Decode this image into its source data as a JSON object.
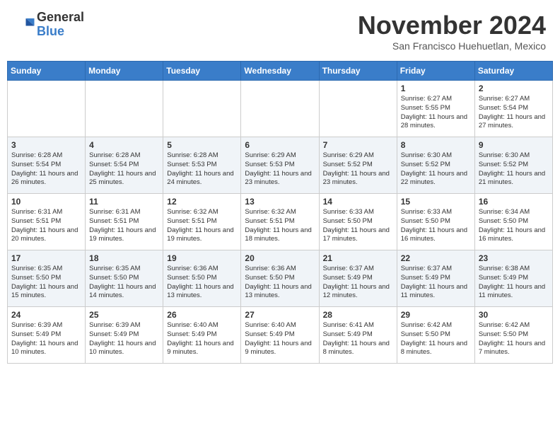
{
  "header": {
    "logo": {
      "general": "General",
      "blue": "Blue"
    },
    "title": "November 2024",
    "location": "San Francisco Huehuetlan, Mexico"
  },
  "weekdays": [
    "Sunday",
    "Monday",
    "Tuesday",
    "Wednesday",
    "Thursday",
    "Friday",
    "Saturday"
  ],
  "weeks": [
    [
      {
        "day": "",
        "info": ""
      },
      {
        "day": "",
        "info": ""
      },
      {
        "day": "",
        "info": ""
      },
      {
        "day": "",
        "info": ""
      },
      {
        "day": "",
        "info": ""
      },
      {
        "day": "1",
        "info": "Sunrise: 6:27 AM\nSunset: 5:55 PM\nDaylight: 11 hours and 28 minutes."
      },
      {
        "day": "2",
        "info": "Sunrise: 6:27 AM\nSunset: 5:54 PM\nDaylight: 11 hours and 27 minutes."
      }
    ],
    [
      {
        "day": "3",
        "info": "Sunrise: 6:28 AM\nSunset: 5:54 PM\nDaylight: 11 hours and 26 minutes."
      },
      {
        "day": "4",
        "info": "Sunrise: 6:28 AM\nSunset: 5:54 PM\nDaylight: 11 hours and 25 minutes."
      },
      {
        "day": "5",
        "info": "Sunrise: 6:28 AM\nSunset: 5:53 PM\nDaylight: 11 hours and 24 minutes."
      },
      {
        "day": "6",
        "info": "Sunrise: 6:29 AM\nSunset: 5:53 PM\nDaylight: 11 hours and 23 minutes."
      },
      {
        "day": "7",
        "info": "Sunrise: 6:29 AM\nSunset: 5:52 PM\nDaylight: 11 hours and 23 minutes."
      },
      {
        "day": "8",
        "info": "Sunrise: 6:30 AM\nSunset: 5:52 PM\nDaylight: 11 hours and 22 minutes."
      },
      {
        "day": "9",
        "info": "Sunrise: 6:30 AM\nSunset: 5:52 PM\nDaylight: 11 hours and 21 minutes."
      }
    ],
    [
      {
        "day": "10",
        "info": "Sunrise: 6:31 AM\nSunset: 5:51 PM\nDaylight: 11 hours and 20 minutes."
      },
      {
        "day": "11",
        "info": "Sunrise: 6:31 AM\nSunset: 5:51 PM\nDaylight: 11 hours and 19 minutes."
      },
      {
        "day": "12",
        "info": "Sunrise: 6:32 AM\nSunset: 5:51 PM\nDaylight: 11 hours and 19 minutes."
      },
      {
        "day": "13",
        "info": "Sunrise: 6:32 AM\nSunset: 5:51 PM\nDaylight: 11 hours and 18 minutes."
      },
      {
        "day": "14",
        "info": "Sunrise: 6:33 AM\nSunset: 5:50 PM\nDaylight: 11 hours and 17 minutes."
      },
      {
        "day": "15",
        "info": "Sunrise: 6:33 AM\nSunset: 5:50 PM\nDaylight: 11 hours and 16 minutes."
      },
      {
        "day": "16",
        "info": "Sunrise: 6:34 AM\nSunset: 5:50 PM\nDaylight: 11 hours and 16 minutes."
      }
    ],
    [
      {
        "day": "17",
        "info": "Sunrise: 6:35 AM\nSunset: 5:50 PM\nDaylight: 11 hours and 15 minutes."
      },
      {
        "day": "18",
        "info": "Sunrise: 6:35 AM\nSunset: 5:50 PM\nDaylight: 11 hours and 14 minutes."
      },
      {
        "day": "19",
        "info": "Sunrise: 6:36 AM\nSunset: 5:50 PM\nDaylight: 11 hours and 13 minutes."
      },
      {
        "day": "20",
        "info": "Sunrise: 6:36 AM\nSunset: 5:50 PM\nDaylight: 11 hours and 13 minutes."
      },
      {
        "day": "21",
        "info": "Sunrise: 6:37 AM\nSunset: 5:49 PM\nDaylight: 11 hours and 12 minutes."
      },
      {
        "day": "22",
        "info": "Sunrise: 6:37 AM\nSunset: 5:49 PM\nDaylight: 11 hours and 11 minutes."
      },
      {
        "day": "23",
        "info": "Sunrise: 6:38 AM\nSunset: 5:49 PM\nDaylight: 11 hours and 11 minutes."
      }
    ],
    [
      {
        "day": "24",
        "info": "Sunrise: 6:39 AM\nSunset: 5:49 PM\nDaylight: 11 hours and 10 minutes."
      },
      {
        "day": "25",
        "info": "Sunrise: 6:39 AM\nSunset: 5:49 PM\nDaylight: 11 hours and 10 minutes."
      },
      {
        "day": "26",
        "info": "Sunrise: 6:40 AM\nSunset: 5:49 PM\nDaylight: 11 hours and 9 minutes."
      },
      {
        "day": "27",
        "info": "Sunrise: 6:40 AM\nSunset: 5:49 PM\nDaylight: 11 hours and 9 minutes."
      },
      {
        "day": "28",
        "info": "Sunrise: 6:41 AM\nSunset: 5:49 PM\nDaylight: 11 hours and 8 minutes."
      },
      {
        "day": "29",
        "info": "Sunrise: 6:42 AM\nSunset: 5:50 PM\nDaylight: 11 hours and 8 minutes."
      },
      {
        "day": "30",
        "info": "Sunrise: 6:42 AM\nSunset: 5:50 PM\nDaylight: 11 hours and 7 minutes."
      }
    ]
  ]
}
